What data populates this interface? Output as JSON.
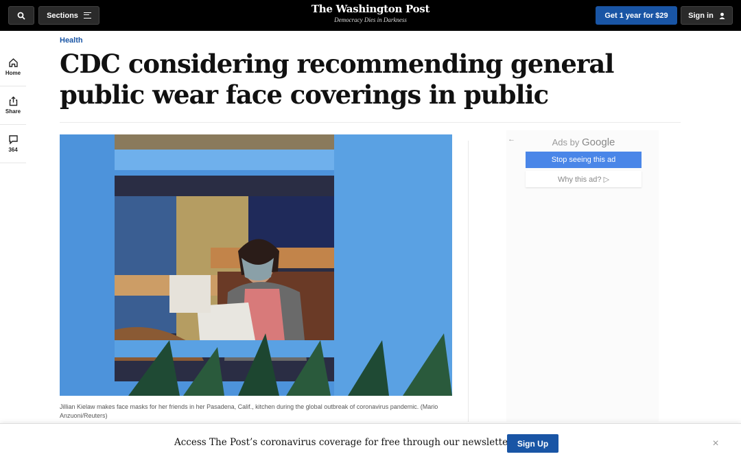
{
  "header": {
    "sections_label": "Sections",
    "masthead": "The Washington Post",
    "slogan": "Democracy Dies in Darkness",
    "subscribe_label": "Get 1 year for $29",
    "signin_label": "Sign in",
    "colors": {
      "bar": "#000000",
      "subscribe": "#1955a5"
    }
  },
  "rail": {
    "items": [
      {
        "label": "Home",
        "icon": "home-icon"
      },
      {
        "label": "Share",
        "icon": "share-icon"
      },
      {
        "label": "364",
        "icon": "comment-icon"
      }
    ]
  },
  "article": {
    "kicker": "Health",
    "headline": "CDC considering recommending general public wear face coverings in public",
    "caption": "Jillian Kielaw makes face masks for her friends in her Pasadena, Calif., kitchen during the global outbreak of coronavirus pandemic. (Mario Anzuoni/Reuters)"
  },
  "ad": {
    "back": "←",
    "ads_by": "Ads by",
    "google": "Google",
    "stop_label": "Stop seeing this ad",
    "why_label": "Why this ad? ▷"
  },
  "banner": {
    "text": "Access The Post’s coronavirus coverage for free through our newsletter.",
    "signup_label": "Sign Up",
    "close": "×"
  }
}
